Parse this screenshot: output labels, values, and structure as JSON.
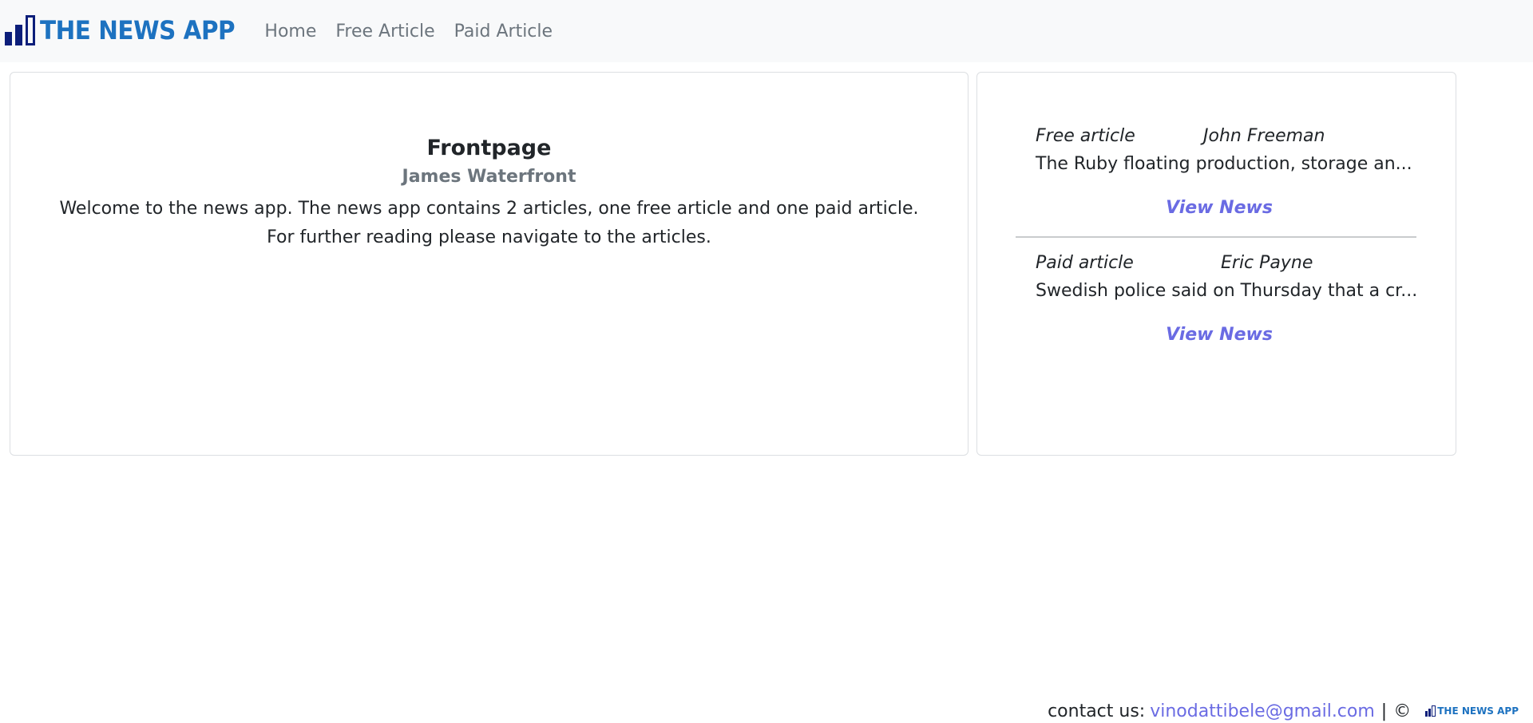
{
  "brand": {
    "name": "THE NEWS APP",
    "icon": "bar-chart-logo-icon",
    "colors": {
      "text": "#1d72c0",
      "mark": "#0c1e7a"
    }
  },
  "nav": {
    "items": [
      {
        "label": "Home"
      },
      {
        "label": "Free Article"
      },
      {
        "label": "Paid Article"
      }
    ]
  },
  "main": {
    "title": "Frontpage",
    "author": "James Waterfront",
    "text_line1": "Welcome to the news app. The news app contains 2 articles, one free article and one paid article.",
    "text_line2": "For further reading please navigate to the articles."
  },
  "sidebar": {
    "articles": [
      {
        "type": "Free article",
        "author": "John Freeman",
        "excerpt": "The Ruby floating production, storage an...",
        "link_label": "View News"
      },
      {
        "type": "Paid article",
        "author": "Eric Payne",
        "excerpt": "Swedish police said on Thursday that a cr...",
        "link_label": "View News"
      }
    ],
    "link_color": "#6a6be3"
  },
  "footer": {
    "contact_label": "contact us:",
    "email": "vinodattibele@gmail.com",
    "separator": "|",
    "copyright": "©",
    "logo_text": "THE NEWS APP"
  }
}
